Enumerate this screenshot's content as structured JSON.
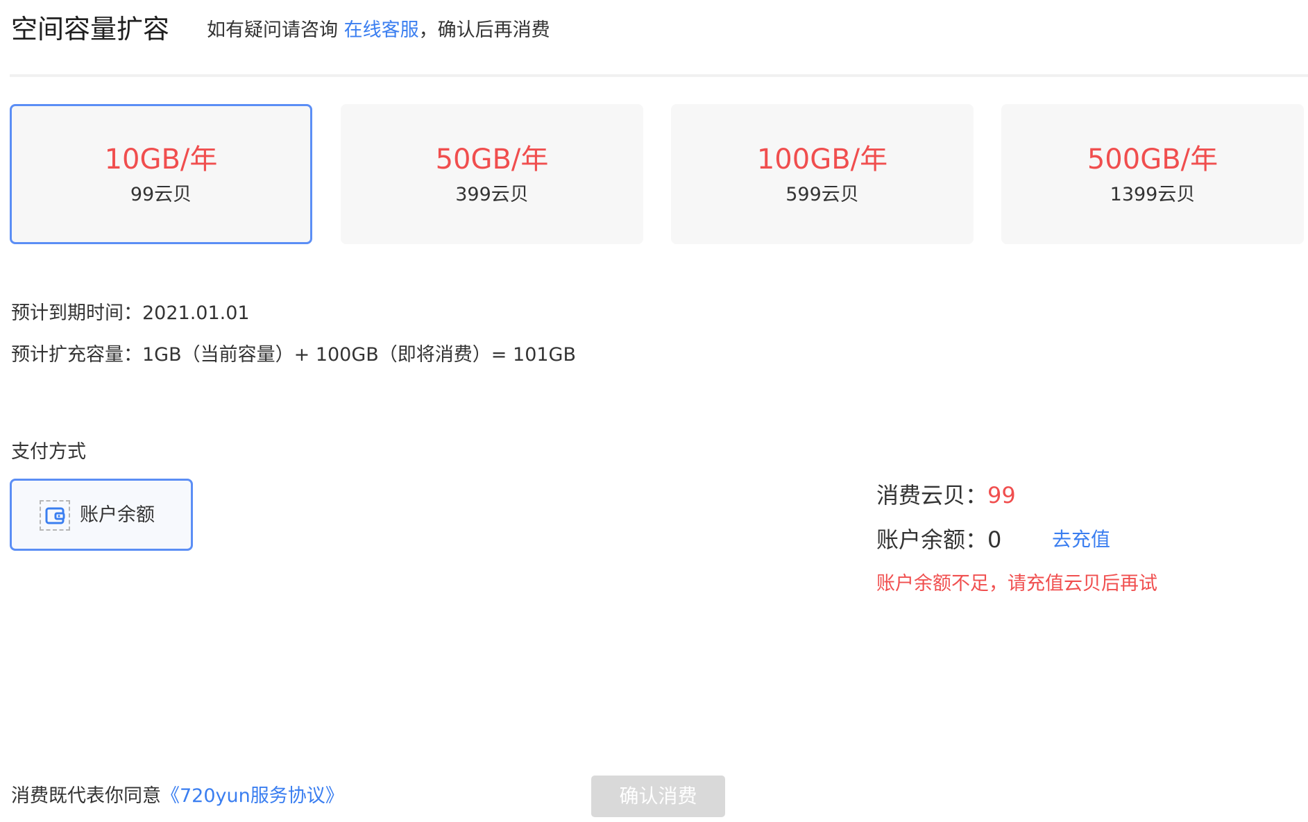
{
  "header": {
    "title": "空间容量扩容",
    "notice_prefix": "如有疑问请咨询 ",
    "notice_link": "在线客服",
    "notice_suffix": "，确认后再消费"
  },
  "plans": [
    {
      "size": "10GB/年",
      "price": "99云贝",
      "selected": true
    },
    {
      "size": "50GB/年",
      "price": "399云贝",
      "selected": false
    },
    {
      "size": "100GB/年",
      "price": "599云贝",
      "selected": false
    },
    {
      "size": "500GB/年",
      "price": "1399云贝",
      "selected": false
    }
  ],
  "info": {
    "expiry_label": "预计到期时间：",
    "expiry_value": "2021.01.01",
    "capacity_label": "预计扩充容量：",
    "capacity_value": "1GB（当前容量）+ 100GB（即将消费）= 101GB"
  },
  "payment": {
    "section_label": "支付方式",
    "method_label": "账户余额",
    "method_icon": "wallet-icon"
  },
  "summary": {
    "cost_label": "消费云贝：",
    "cost_value": "99",
    "balance_label": "账户余额：",
    "balance_value": "0",
    "recharge_link": "去充值",
    "warning": "账户余额不足，请充值云贝后再试"
  },
  "footer": {
    "agree_text": "消费既代表你同意",
    "agree_link": "《720yun服务协议》",
    "confirm_label": "确认消费"
  },
  "colors": {
    "accent_blue": "#3a7ef0",
    "selected_border": "#5b8ef5",
    "price_red": "#f04e4e",
    "disabled_button": "#d9d9d9"
  }
}
